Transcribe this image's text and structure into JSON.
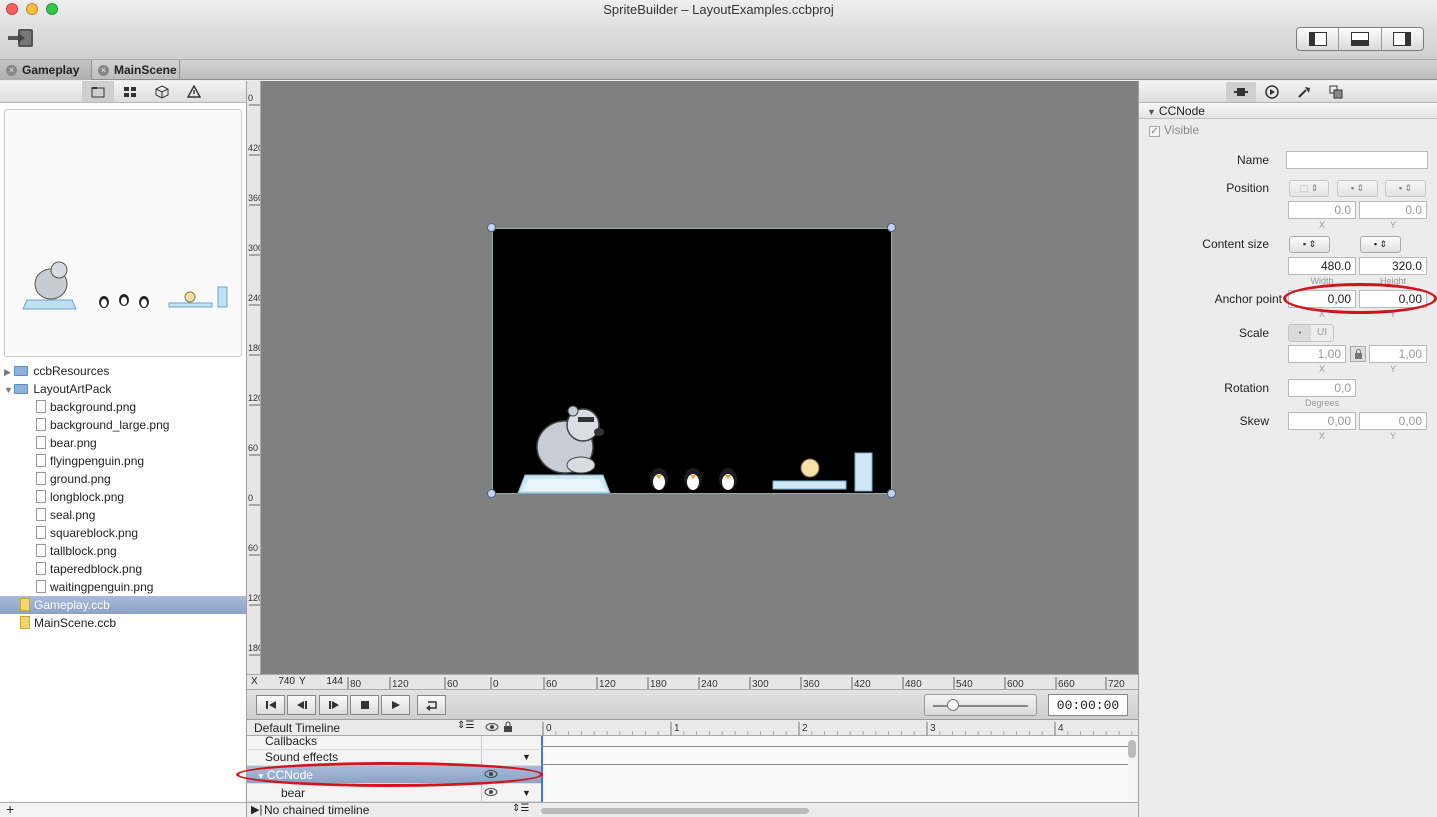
{
  "window": {
    "title": "SpriteBuilder – LayoutExamples.ccbproj"
  },
  "toolbar": {
    "back_icon": "exit-icon",
    "view_icons": [
      "left-panel-icon",
      "bottom-panel-icon",
      "right-panel-icon"
    ]
  },
  "tabs": [
    {
      "label": "Gameplay"
    },
    {
      "label": "MainScene"
    }
  ],
  "left": {
    "tool_icons": [
      "folder-icon",
      "grid-icon",
      "cube-icon",
      "warning-icon"
    ],
    "tree": [
      {
        "label": "ccbResources",
        "kind": "folder",
        "open": false
      },
      {
        "label": "LayoutArtPack",
        "kind": "folder",
        "open": true
      },
      {
        "label": "background.png",
        "kind": "file"
      },
      {
        "label": "background_large.png",
        "kind": "file"
      },
      {
        "label": "bear.png",
        "kind": "file"
      },
      {
        "label": "flyingpenguin.png",
        "kind": "file"
      },
      {
        "label": "ground.png",
        "kind": "file"
      },
      {
        "label": "longblock.png",
        "kind": "file"
      },
      {
        "label": "seal.png",
        "kind": "file"
      },
      {
        "label": "squareblock.png",
        "kind": "file"
      },
      {
        "label": "tallblock.png",
        "kind": "file"
      },
      {
        "label": "taperedblock.png",
        "kind": "file"
      },
      {
        "label": "waitingpenguin.png",
        "kind": "file"
      },
      {
        "label": "Gameplay.ccb",
        "kind": "ccb",
        "selected": true
      },
      {
        "label": "MainScene.ccb",
        "kind": "ccb"
      }
    ],
    "add_label": "+"
  },
  "rulers": {
    "x_label": "X",
    "x_value": "740",
    "y_label": "Y",
    "y_value": "144",
    "h_ticks": [
      "80",
      "120",
      "60",
      "0",
      "60",
      "120",
      "180",
      "240",
      "300",
      "360",
      "420",
      "480",
      "540",
      "600",
      "660",
      "720"
    ],
    "v_ticks": [
      "0",
      "420",
      "360",
      "300",
      "240",
      "180",
      "120",
      "60",
      "0",
      "60",
      "120",
      "180"
    ]
  },
  "playback": {
    "time": "00:00:00",
    "icons": [
      "rewind-start-icon",
      "step-back-icon",
      "step-forward-icon",
      "stop-icon",
      "play-icon",
      "loop-icon"
    ]
  },
  "timeline": {
    "name": "Default Timeline",
    "ticks": [
      "0",
      "1",
      "2",
      "3",
      "4"
    ],
    "rows": [
      {
        "label": "Callbacks"
      },
      {
        "label": "Sound effects"
      },
      {
        "label": "CCNode",
        "selected": true
      },
      {
        "label": "bear"
      }
    ],
    "chain": "No chained timeline"
  },
  "inspector": {
    "tool_icons": [
      "node-props-icon",
      "plugin-icon",
      "code-connect-icon",
      "template-icon"
    ],
    "section": "CCNode",
    "visible_label": "Visible",
    "name_label": "Name",
    "name_value": "",
    "position": {
      "label": "Position",
      "x": "0.0",
      "y": "0.0",
      "x_sub": "X",
      "y_sub": "Y"
    },
    "content_size": {
      "label": "Content size",
      "width": "480.0",
      "height": "320.0",
      "w_sub": "Width",
      "h_sub": "Height"
    },
    "anchor": {
      "label": "Anchor point",
      "x": "0,00",
      "y": "0,00",
      "x_sub": "X",
      "y_sub": "Y"
    },
    "scale": {
      "label": "Scale",
      "x": "1,00",
      "y": "1,00",
      "ui_label": "UI",
      "x_sub": "X",
      "y_sub": "Y"
    },
    "rotation": {
      "label": "Rotation",
      "value": "0,0",
      "sub": "Degrees"
    },
    "skew": {
      "label": "Skew",
      "x": "0,00",
      "y": "0,00",
      "x_sub": "X",
      "y_sub": "Y"
    }
  },
  "colors": {
    "selection": "#8ca2c6",
    "canvas": "#808080",
    "highlight_ring": "#d2141c"
  }
}
